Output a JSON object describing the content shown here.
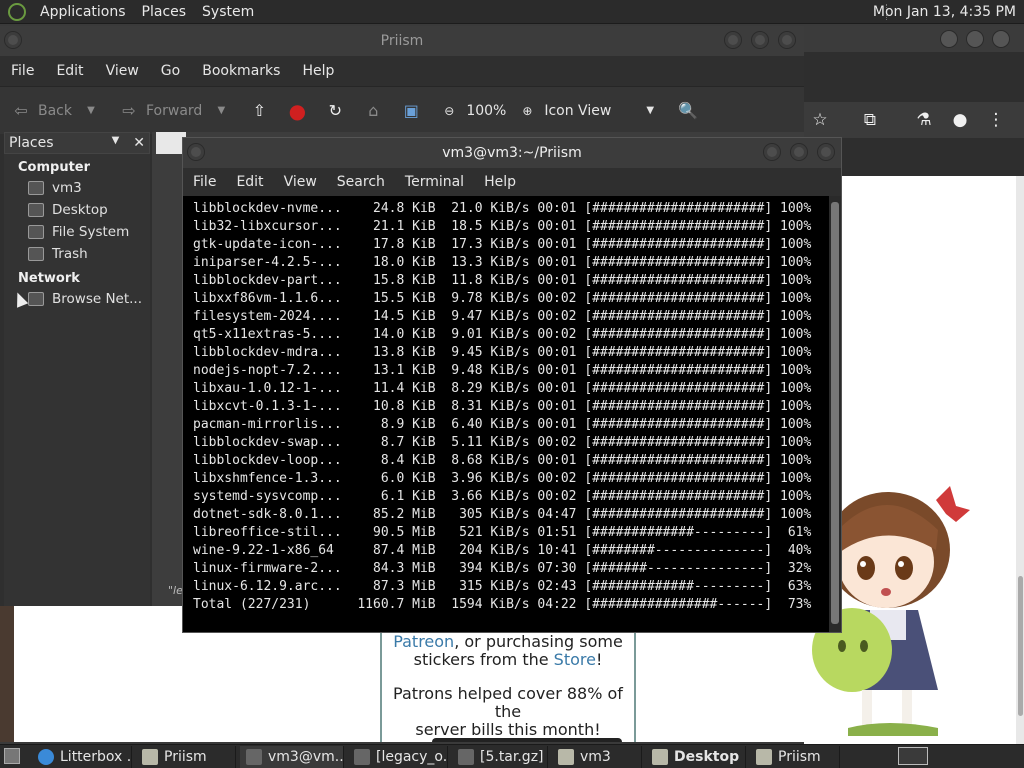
{
  "top_panel": {
    "menus": [
      "Applications",
      "Places",
      "System"
    ],
    "clock": "Mon Jan 13,  4:35 PM"
  },
  "file_manager": {
    "title": "Priism",
    "menus": [
      "File",
      "Edit",
      "View",
      "Go",
      "Bookmarks",
      "Help"
    ],
    "toolbar": {
      "back": "Back",
      "forward": "Forward",
      "zoom": "100%",
      "view_mode": "Icon View"
    },
    "sidepane": {
      "header": "Places",
      "sections": [
        {
          "label": "Computer",
          "items": [
            "vm3",
            "Desktop",
            "File System",
            "Trash"
          ]
        },
        {
          "label": "Network",
          "items": [
            "Browse Net..."
          ]
        }
      ]
    },
    "status_fragment": "\"le"
  },
  "terminal": {
    "title": "vm3@vm3:~/Priism",
    "menus": [
      "File",
      "Edit",
      "View",
      "Search",
      "Terminal",
      "Help"
    ],
    "lines": [
      "libblockdev-nvme...    24.8 KiB  21.0 KiB/s 00:01 [######################] 100%",
      "lib32-libxcursor...    21.1 KiB  18.5 KiB/s 00:01 [######################] 100%",
      "gtk-update-icon-...    17.8 KiB  17.3 KiB/s 00:01 [######################] 100%",
      "iniparser-4.2.5-...    18.0 KiB  13.3 KiB/s 00:01 [######################] 100%",
      "libblockdev-part...    15.8 KiB  11.8 KiB/s 00:01 [######################] 100%",
      "libxxf86vm-1.1.6...    15.5 KiB  9.78 KiB/s 00:02 [######################] 100%",
      "filesystem-2024....    14.5 KiB  9.47 KiB/s 00:02 [######################] 100%",
      "qt5-x11extras-5....    14.0 KiB  9.01 KiB/s 00:02 [######################] 100%",
      "libblockdev-mdra...    13.8 KiB  9.45 KiB/s 00:01 [######################] 100%",
      "nodejs-nopt-7.2....    13.1 KiB  9.48 KiB/s 00:01 [######################] 100%",
      "libxau-1.0.12-1-...    11.4 KiB  8.29 KiB/s 00:01 [######################] 100%",
      "libxcvt-0.1.3-1-...    10.8 KiB  8.31 KiB/s 00:01 [######################] 100%",
      "pacman-mirrorlis...     8.9 KiB  6.40 KiB/s 00:01 [######################] 100%",
      "libblockdev-swap...     8.7 KiB  5.11 KiB/s 00:02 [######################] 100%",
      "libblockdev-loop...     8.4 KiB  8.68 KiB/s 00:01 [######################] 100%",
      "libxshmfence-1.3...     6.0 KiB  3.96 KiB/s 00:02 [######################] 100%",
      "systemd-sysvcomp...     6.1 KiB  3.66 KiB/s 00:02 [######################] 100%",
      "dotnet-sdk-8.0.1...    85.2 MiB   305 KiB/s 04:47 [######################] 100%",
      "libreoffice-stil...    90.5 MiB   521 KiB/s 01:51 [#############---------]  61%",
      "wine-9.22-1-x86_64     87.4 MiB   204 KiB/s 10:41 [########--------------]  40%",
      "linux-firmware-2...    84.3 MiB   394 KiB/s 07:30 [#######---------------]  32%",
      "linux-6.12.9.arc...    87.3 MiB   315 KiB/s 02:43 [#############---------]  63%",
      "Total (227/231)      1160.7 MiB  1594 KiB/s 04:22 [################------]  73%"
    ]
  },
  "webpage": {
    "line1_link": "Patreon",
    "line1_rest": ", or purchasing some",
    "line2_pre": "stickers from the ",
    "line2_link": "Store",
    "line2_post": "!",
    "line3": "Patrons helped cover 88% of the",
    "line4": "server bills this month!"
  },
  "taskbar": {
    "tasks": [
      {
        "label": "Litterbox ...",
        "icon": "chrome-icon"
      },
      {
        "label": "Priism",
        "icon": "folder-icon"
      },
      {
        "label": "vm3@vm...",
        "icon": "terminal-icon"
      },
      {
        "label": "[legacy_o...",
        "icon": "archive-icon"
      },
      {
        "label": "[5.tar.gz]",
        "icon": "archive-icon"
      },
      {
        "label": "vm3",
        "icon": "folder-icon"
      },
      {
        "label": "Desktop",
        "icon": "folder-icon"
      },
      {
        "label": "Priism",
        "icon": "folder-icon"
      }
    ]
  }
}
